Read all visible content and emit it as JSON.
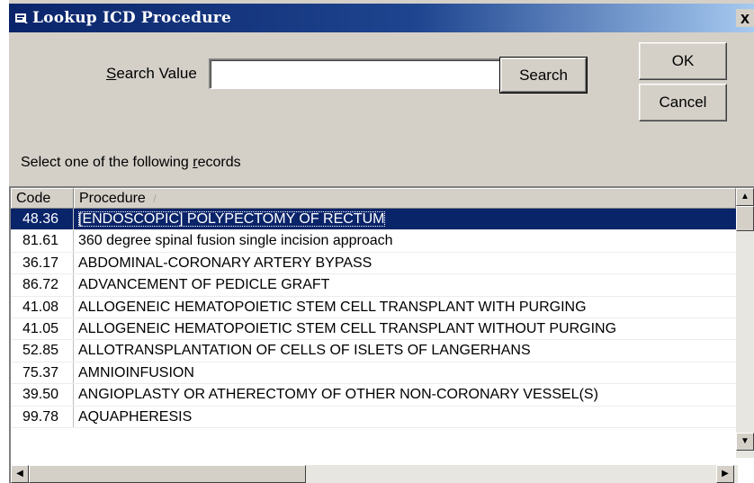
{
  "window": {
    "title": "Lookup ICD Procedure",
    "close_glyph": "x",
    "icon": "app-icon"
  },
  "search": {
    "label": "Search Value",
    "value": "",
    "placeholder": "",
    "button_label": "Search"
  },
  "buttons": {
    "ok_label": "OK",
    "cancel_label": "Cancel"
  },
  "list": {
    "instruction": "Select one of the following records",
    "columns": [
      "Code",
      "Procedure"
    ],
    "sort_indicator": "/",
    "selected_index": 0,
    "rows": [
      {
        "code": "48.36",
        "procedure": "[ENDOSCOPIC] POLYPECTOMY OF RECTUM"
      },
      {
        "code": "81.61",
        "procedure": "360 degree spinal fusion single incision approach"
      },
      {
        "code": "36.17",
        "procedure": "ABDOMINAL-CORONARY ARTERY BYPASS"
      },
      {
        "code": "86.72",
        "procedure": "ADVANCEMENT OF PEDICLE GRAFT"
      },
      {
        "code": "41.08",
        "procedure": "ALLOGENEIC HEMATOPOIETIC STEM CELL TRANSPLANT WITH PURGING"
      },
      {
        "code": "41.05",
        "procedure": "ALLOGENEIC HEMATOPOIETIC STEM CELL TRANSPLANT WITHOUT PURGING"
      },
      {
        "code": "52.85",
        "procedure": "ALLOTRANSPLANTATION OF CELLS OF ISLETS OF LANGERHANS"
      },
      {
        "code": "75.37",
        "procedure": "AMNIOINFUSION"
      },
      {
        "code": "39.50",
        "procedure": "ANGIOPLASTY OR ATHERECTOMY OF OTHER NON-CORONARY VESSEL(S)"
      },
      {
        "code": "99.78",
        "procedure": "AQUAPHERESIS"
      }
    ]
  },
  "colors": {
    "titlebar": "#0a246a",
    "selection": "#0a246a",
    "face": "#d4d0c8"
  }
}
